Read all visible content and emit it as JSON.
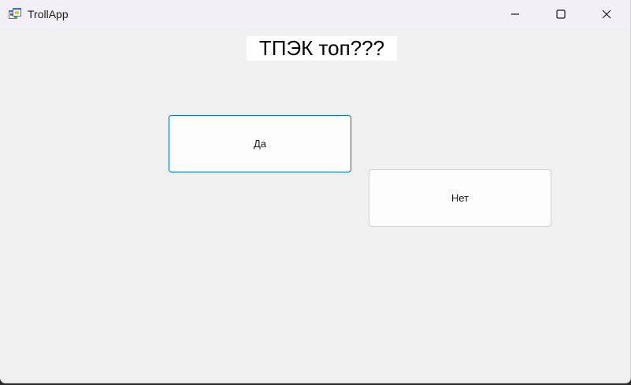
{
  "window": {
    "title": "TrollApp",
    "icon": "windows-forms-app-icon",
    "controls": {
      "minimize": "minimize-icon",
      "maximize": "maximize-icon",
      "close": "close-icon"
    }
  },
  "main": {
    "question": "ТПЭК топ???",
    "yes_label": "Да",
    "no_label": "Нет"
  },
  "colors": {
    "titlebar_bg": "#f3eff6",
    "client_bg": "#f0f0f0",
    "focus_border": "#0067c0",
    "question_bg": "#ffffff"
  }
}
